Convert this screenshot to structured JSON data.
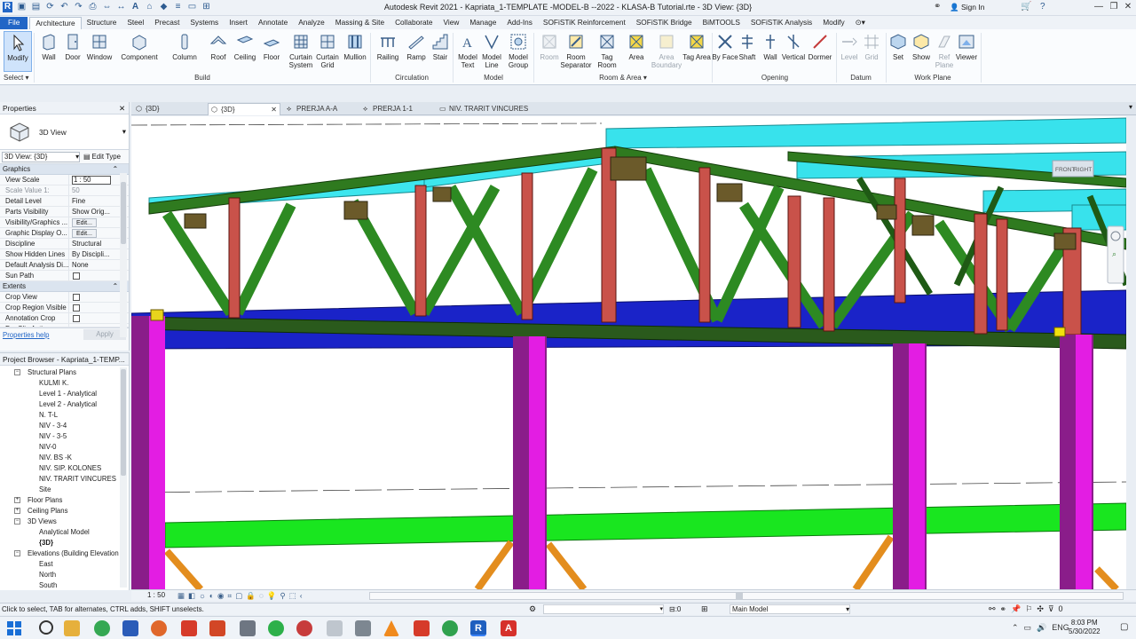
{
  "window": {
    "title": "Autodesk Revit 2021 - Kapriata_1-TEMPLATE -MODEL-B --2022 - KLASA-B Tutorial.rte - 3D View: {3D}",
    "sign_in": "Sign In"
  },
  "menu": [
    "File",
    "Architecture",
    "Structure",
    "Steel",
    "Precast",
    "Systems",
    "Insert",
    "Annotate",
    "Analyze",
    "Massing & Site",
    "Collaborate",
    "View",
    "Manage",
    "Add-Ins",
    "SOFiSTiK Reinforcement",
    "SOFiSTiK Bridge",
    "BiMTOOLS",
    "SOFiSTiK Analysis",
    "Modify"
  ],
  "ribbon": {
    "modify": "Modify",
    "select": "Select ▾",
    "build": [
      "Wall",
      "Door",
      "Window",
      "Component",
      "Column",
      "Roof",
      "Ceiling",
      "Floor",
      "Curtain System",
      "Curtain Grid",
      "Mullion"
    ],
    "circulation": [
      "Railing",
      "Ramp",
      "Stair"
    ],
    "model": [
      "Model Text",
      "Model Line",
      "Model Group"
    ],
    "room_area": [
      "Room",
      "Room Separator",
      "Tag Room",
      "Area",
      "Area Boundary",
      "Tag Area"
    ],
    "opening": [
      "By Face",
      "Shaft",
      "Wall",
      "Vertical",
      "Dormer"
    ],
    "datum": [
      "Level",
      "Grid"
    ],
    "work_plane": [
      "Set",
      "Show",
      "Ref Plane",
      "Viewer"
    ],
    "groups": {
      "build": "Build",
      "circulation": "Circulation",
      "model": "Model",
      "room_area": "Room & Area ▾",
      "opening": "Opening",
      "datum": "Datum",
      "work_plane": "Work Plane"
    }
  },
  "properties": {
    "header": "Properties",
    "type": "3D View",
    "selector": "3D View: {3D}",
    "edit_type": "Edit Type",
    "graphics_section": "Graphics",
    "rows": [
      {
        "k": "View Scale",
        "v": "1 : 50"
      },
      {
        "k": "Scale Value   1:",
        "v": "50"
      },
      {
        "k": "Detail Level",
        "v": "Fine"
      },
      {
        "k": "Parts Visibility",
        "v": "Show Orig..."
      },
      {
        "k": "Visibility/Graphics ...",
        "v": "Edit..."
      },
      {
        "k": "Graphic Display O...",
        "v": "Edit..."
      },
      {
        "k": "Discipline",
        "v": "Structural"
      },
      {
        "k": "Show Hidden Lines",
        "v": "By Discipli..."
      },
      {
        "k": "Default Analysis Di...",
        "v": "None"
      },
      {
        "k": "Sun Path",
        "v": ""
      }
    ],
    "extents_section": "Extents",
    "extents": [
      "Crop View",
      "Crop Region Visible",
      "Annotation Crop",
      "Far Clip Active"
    ],
    "help": "Properties help",
    "apply": "Apply"
  },
  "browser": {
    "header": "Project Browser - Kapriata_1-TEMP...",
    "items": [
      {
        "t": "Structural Plans",
        "lvl": 1,
        "exp": "−"
      },
      {
        "t": "KULMI K.",
        "lvl": 2
      },
      {
        "t": "Level 1 - Analytical",
        "lvl": 2
      },
      {
        "t": "Level 2 - Analytical",
        "lvl": 2
      },
      {
        "t": "N. T-L",
        "lvl": 2
      },
      {
        "t": "NIV - 3-4",
        "lvl": 2
      },
      {
        "t": "NIV - 3-5",
        "lvl": 2
      },
      {
        "t": "NIV-0",
        "lvl": 2
      },
      {
        "t": "NIV. BS -K",
        "lvl": 2
      },
      {
        "t": "NIV. SIP. KOLONES",
        "lvl": 2
      },
      {
        "t": "NIV. TRARIT VINCURES",
        "lvl": 2
      },
      {
        "t": "Site",
        "lvl": 2
      },
      {
        "t": "Floor Plans",
        "lvl": 1,
        "exp": "+"
      },
      {
        "t": "Ceiling Plans",
        "lvl": 1,
        "exp": "+"
      },
      {
        "t": "3D Views",
        "lvl": 1,
        "exp": "−"
      },
      {
        "t": "Analytical Model",
        "lvl": 2
      },
      {
        "t": "{3D}",
        "lvl": 2,
        "bold": true
      },
      {
        "t": "Elevations (Building Elevation",
        "lvl": 1,
        "exp": "−"
      },
      {
        "t": "East",
        "lvl": 2
      },
      {
        "t": "North",
        "lvl": 2
      },
      {
        "t": "South",
        "lvl": 2
      }
    ]
  },
  "tabs": [
    "{3D}",
    "{3D}",
    "PRERJA A-A",
    "PRERJA 1-1",
    "NIV. TRARIT VINCURES"
  ],
  "viewcube": {
    "front": "FRONT",
    "right": "RIGHT"
  },
  "status": {
    "scale": "1 : 50",
    "hint": "Click to select, TAB for alternates, CTRL adds, SHIFT unselects.",
    "zero": ":0",
    "model": "Main Model",
    "filter": "0",
    "lang": "ENG",
    "time": "8:03 PM",
    "date": "5/30/2022"
  }
}
